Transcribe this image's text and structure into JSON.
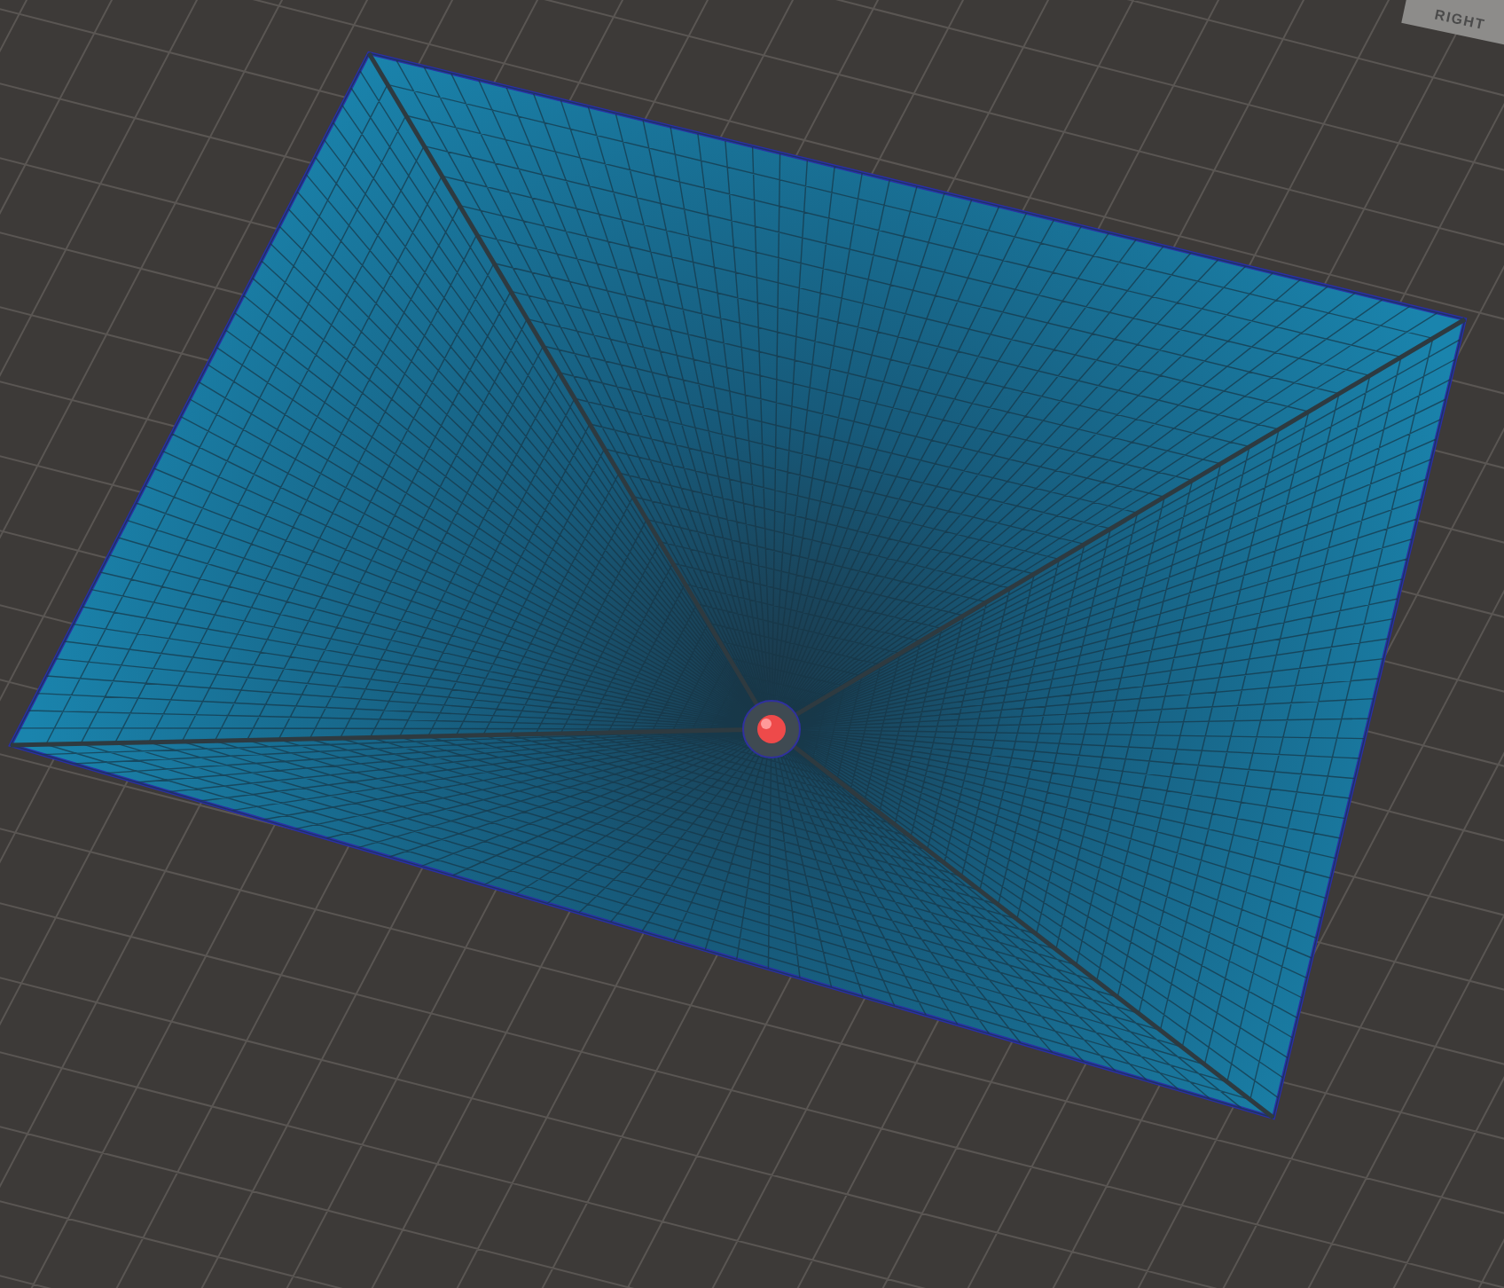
{
  "view_cube": {
    "label": "RIGHT"
  }
}
